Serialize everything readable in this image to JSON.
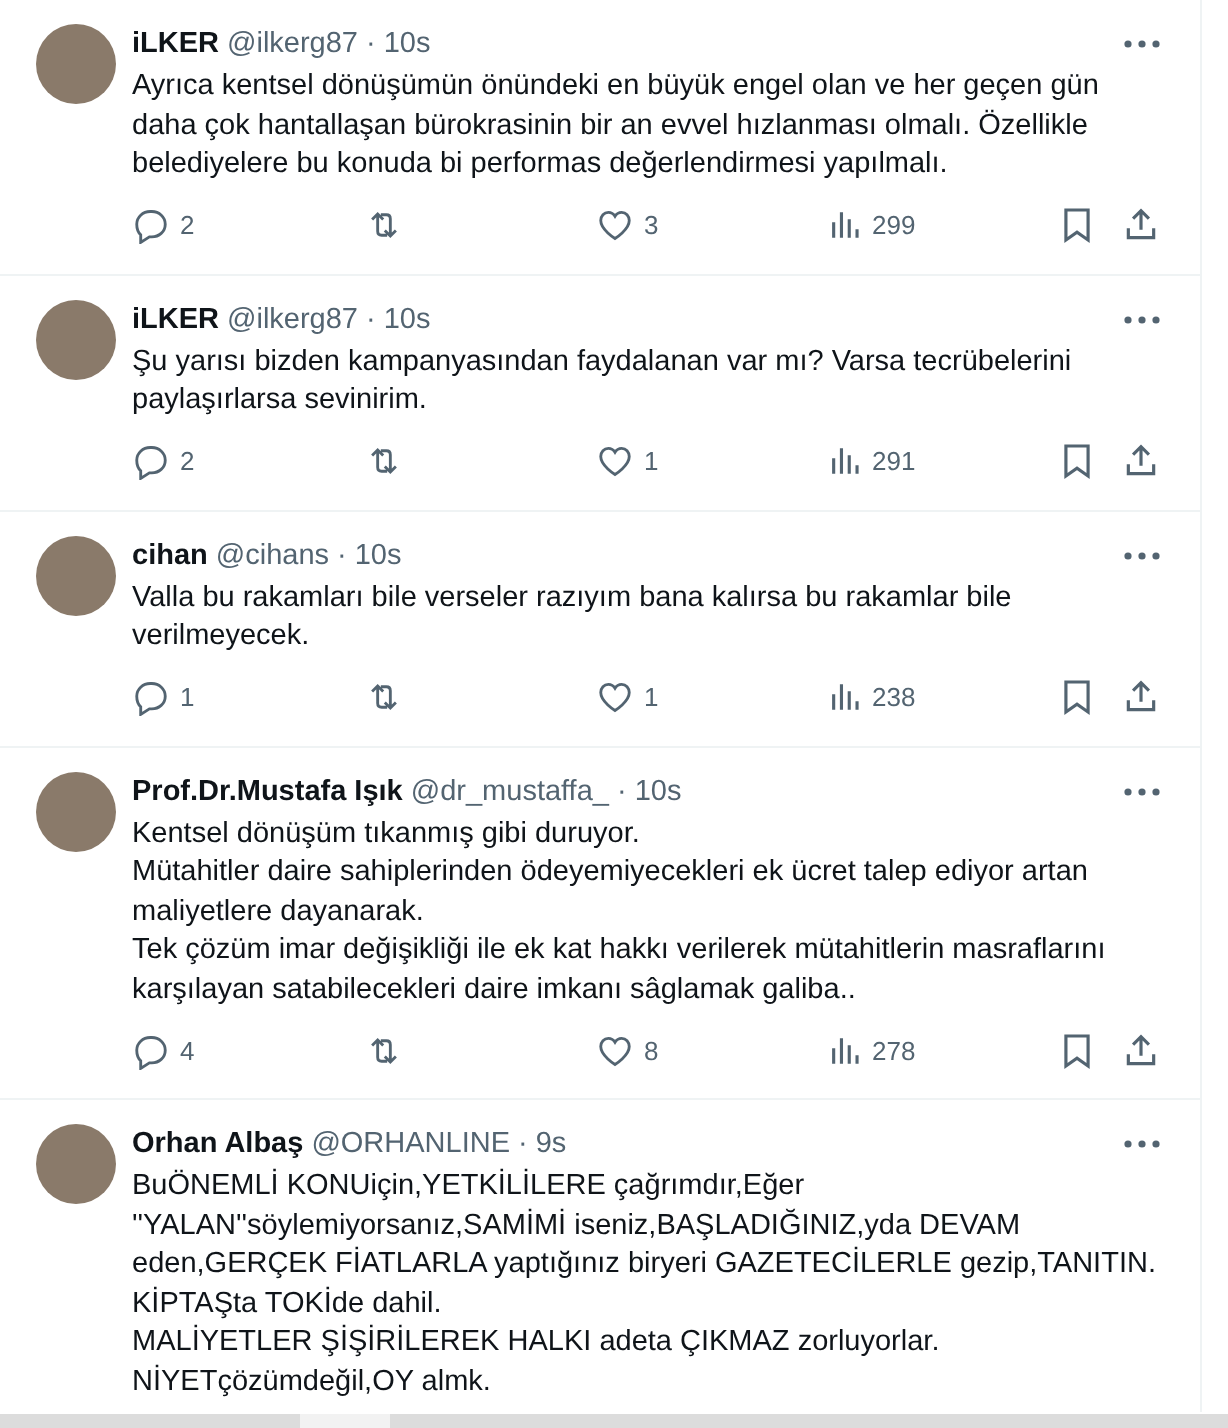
{
  "tweets": [
    {
      "name": "iLKER",
      "handle": "@ilkerg87",
      "sep": "·",
      "time": "10s",
      "text": "Ayrıca kentsel dönüşümün önündeki en büyük engel olan ve her geçen gün daha çok hantallaşan bürokrasinin bir an evvel hızlanması olmalı. Özellikle belediyelere bu konuda bi performas değerlendirmesi yapılmalı.",
      "actions": {
        "replies": "2",
        "likes": "3",
        "views": "299"
      }
    },
    {
      "name": "iLKER",
      "handle": "@ilkerg87",
      "sep": "·",
      "time": "10s",
      "text": "Şu yarısı bizden kampanyasından faydalanan var mı? Varsa tecrübelerini paylaşırlarsa sevinirim.",
      "actions": {
        "replies": "2",
        "likes": "1",
        "views": "291"
      }
    },
    {
      "name": "cihan",
      "handle": "@cihans",
      "sep": "·",
      "time": "10s",
      "text": "Valla bu rakamları bile verseler razıyım bana kalırsa bu rakamlar bile verilmeyecek.",
      "actions": {
        "replies": "1",
        "likes": "1",
        "views": "238"
      }
    },
    {
      "name": "Prof.Dr.Mustafa Işık",
      "handle": "@dr_mustaffa_",
      "sep": "·",
      "time": "10s",
      "text": "Kentsel dönüşüm tıkanmış gibi duruyor.\nMütahitler daire sahiplerinden ödeyemiyecekleri ek ücret talep ediyor artan maliyetlere dayanarak.\nTek çözüm imar değişikliği ile ek kat hakkı verilerek mütahitlerin masraflarını karşılayan satabilecekleri daire imkanı sâglamak galiba..",
      "actions": {
        "replies": "4",
        "likes": "8",
        "views": "278"
      }
    },
    {
      "name": "Orhan Albaş",
      "handle": "@ORHANLINE",
      "sep": "·",
      "time": "9s",
      "text": "BuÖNEMLİ KONUiçin,YETKİLİLERE çağrımdır,Eğer\n''YALAN''söylemiyorsanız,SAMİMİ iseniz,BAŞLADIĞINIZ,yda DEVAM eden,GERÇEK FİATLARLA yaptığınız biryeri GAZETECİLERLE  gezip,TANITIN.\nKİPTAŞta TOKİde dahil.\nMALİYETLER ŞİŞİRİLEREK HALKI adeta ÇIKMAZ zorluyorlar.\nNİYETçözümdeğil,OY almk."
    }
  ]
}
